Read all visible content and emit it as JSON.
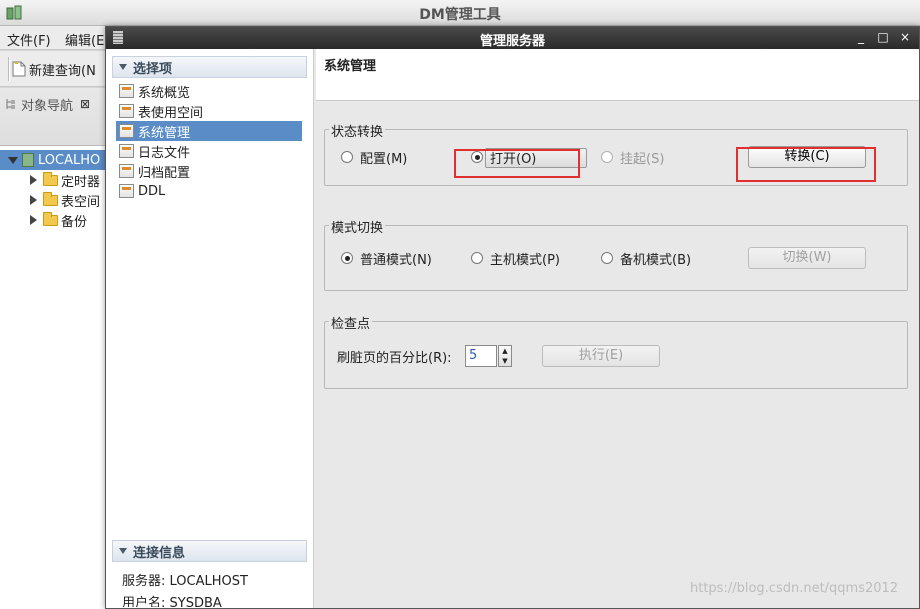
{
  "main_window": {
    "title": "DM管理工具",
    "menu": [
      "文件(F)",
      "编辑(E"
    ],
    "toolbar": {
      "new_query_label": "新建查询(N"
    },
    "nav_panel": {
      "tab_label": "对象导航",
      "tree": {
        "root": "LOCALHO",
        "children": [
          "定时器",
          "表空间",
          "备份"
        ]
      }
    }
  },
  "dialog": {
    "title": "管理服务器",
    "window_buttons": [
      "_",
      "□",
      "×"
    ],
    "options_header": "选择项",
    "options": [
      "系统概览",
      "表使用空间",
      "系统管理",
      "日志文件",
      "归档配置",
      "DDL"
    ],
    "selected_option": "系统管理",
    "connection_header": "连接信息",
    "connection_server": "服务器: LOCALHOST",
    "connection_user_partial": "用户名: SYSDBA",
    "page_title": "系统管理",
    "state_group": {
      "label": "状态转换",
      "options": [
        {
          "label": "配置(M)",
          "checked": false,
          "enabled": true
        },
        {
          "label": "打开(O)",
          "checked": true,
          "enabled": true
        },
        {
          "label": "挂起(S)",
          "checked": false,
          "enabled": false
        }
      ],
      "convert_button": "转换(C)"
    },
    "mode_group": {
      "label": "模式切换",
      "options": [
        {
          "label": "普通模式(N)",
          "checked": true
        },
        {
          "label": "主机模式(P)",
          "checked": false
        },
        {
          "label": "备机模式(B)",
          "checked": false
        }
      ],
      "switch_button": "切换(W)"
    },
    "checkpoint_group": {
      "label": "检查点",
      "flush_label": "刷脏页的百分比(R):",
      "flush_value": "5",
      "execute_button": "执行(E)"
    }
  },
  "watermark": "https://blog.csdn.net/qqms2012",
  "colors": {
    "selection": "#5a8cc8",
    "highlight_box": "#e03030",
    "dialog_titlebar": "#2a2a2a"
  }
}
